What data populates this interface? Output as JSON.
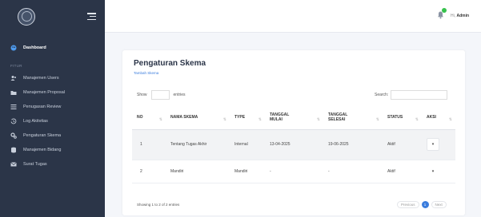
{
  "sidebar": {
    "section_label": "FITUR",
    "items": [
      {
        "label": "Dashboard",
        "icon": "palette-icon"
      },
      {
        "label": "Manajemen Users",
        "icon": "users-icon"
      },
      {
        "label": "Manajemen Proposal",
        "icon": "folder-icon"
      },
      {
        "label": "Penugasan Review",
        "icon": "list-icon"
      },
      {
        "label": "Log Aktivitas",
        "icon": "history-icon"
      },
      {
        "label": "Pengaturan Skema",
        "icon": "cogs-icon"
      },
      {
        "label": "Manajemen Bidang",
        "icon": "database-icon"
      },
      {
        "label": "Surat Tugas",
        "icon": "envelope-icon"
      }
    ]
  },
  "topbar": {
    "greeting": "Hi,",
    "user": "Admin"
  },
  "card": {
    "title": "Pengaturan Skema",
    "add_link": "Tambah Skema",
    "show_label": "Show",
    "entries_label": "entries",
    "search_label": "Search:",
    "columns": [
      "NO",
      "NAMA SKEMA",
      "TYPE",
      "TANGGAL MULAI",
      "TANGGAL SELESAI",
      "STATUS",
      "AKSI"
    ],
    "rows": [
      {
        "no": "1",
        "nama": "Tentang Tugas Akhir",
        "type": "Internal",
        "mulai": "13-04-2025",
        "selesai": "19-06-2025",
        "status": "Aktif"
      },
      {
        "no": "2",
        "nama": "Mandiri",
        "type": "Mandiri",
        "mulai": "-",
        "selesai": "-",
        "status": "Aktif"
      }
    ],
    "info": "Showing 1 to 2 of 2 entries",
    "pager": {
      "previous": "Previous",
      "current": "1",
      "next": "Next"
    }
  },
  "colors": {
    "sidebar": "#2b3548",
    "accent": "#3b7ddd",
    "notification": "#36c14c"
  }
}
